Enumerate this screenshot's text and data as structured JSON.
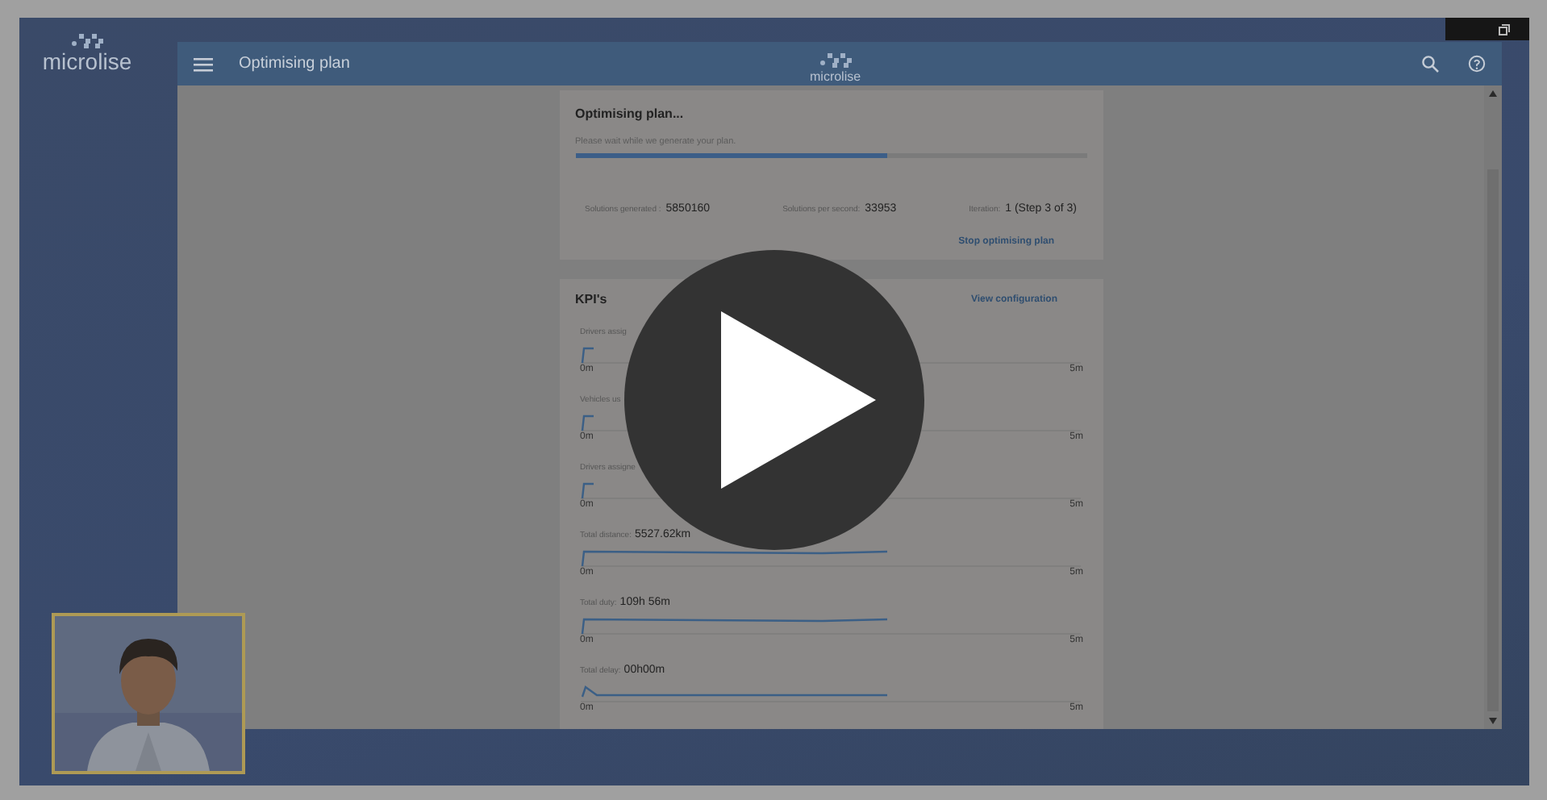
{
  "sidebar": {
    "logo": "microlise"
  },
  "app": {
    "title": "Optimising plan",
    "logo": "microlise"
  },
  "progress_card": {
    "title": "Optimising plan...",
    "subtitle": "Please wait while we generate your plan.",
    "level": 0.61,
    "stats": [
      {
        "label": "Solutions generated :",
        "value": "5850160"
      },
      {
        "label": "Solutions per second:",
        "value": "33953"
      },
      {
        "label": "Iteration:",
        "value": "1 (Step 3 of 3)"
      }
    ],
    "stop_link": "Stop optimising plan"
  },
  "kpi_card": {
    "title": "KPI's",
    "config_link": "View configuration",
    "kpis": [
      {
        "label": "Drivers assig",
        "kind": "flat",
        "axis_start": "0m",
        "axis_end": "5m"
      },
      {
        "label": "Vehicles us",
        "kind": "flat",
        "axis_start": "0m",
        "axis_end": "5m"
      },
      {
        "label": "Drivers assigne",
        "kind": "flat",
        "axis_start": "0m",
        "axis_end": "5m"
      },
      {
        "label": "Total distance:",
        "value": "5527.62km",
        "kind": "line",
        "axis_start": "0m",
        "axis_end": "5m"
      },
      {
        "label": "Total duty:",
        "value": "109h 56m",
        "kind": "line",
        "axis_start": "0m",
        "axis_end": "5m"
      },
      {
        "label": "Total delay:",
        "value": "00h00m",
        "kind": "bumpy",
        "axis_start": "0m",
        "axis_end": "5m"
      }
    ]
  },
  "player": {
    "paused": true
  }
}
